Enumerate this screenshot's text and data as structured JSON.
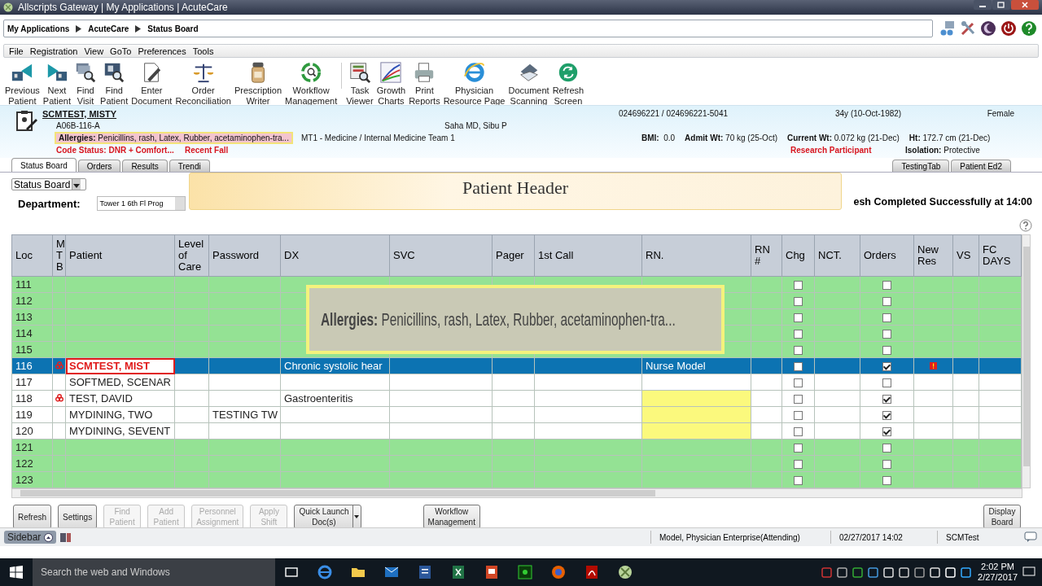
{
  "window": {
    "title": "Allscripts Gateway | My Applications | AcuteCare"
  },
  "breadcrumb": [
    "My Applications",
    "AcuteCare",
    "Status Board"
  ],
  "menu": [
    "File",
    "Registration",
    "View",
    "GoTo",
    "Preferences",
    "Tools"
  ],
  "toolbar": [
    {
      "lines": [
        "Previous",
        "Patient"
      ]
    },
    {
      "lines": [
        "Next",
        "Patient"
      ]
    },
    {
      "lines": [
        "Find",
        "Visit"
      ]
    },
    {
      "lines": [
        "Find",
        "Patient"
      ]
    },
    {
      "lines": [
        "Enter",
        "Document"
      ]
    },
    {
      "lines": [
        "Order",
        "Reconciliation"
      ]
    },
    {
      "lines": [
        "Prescription",
        "Writer"
      ]
    },
    {
      "lines": [
        "Workflow",
        "Management"
      ]
    },
    {
      "lines": [
        "Task",
        "Viewer"
      ]
    },
    {
      "lines": [
        "Growth",
        "Charts"
      ]
    },
    {
      "lines": [
        "Print",
        "Reports"
      ]
    },
    {
      "lines": [
        "Physician",
        "Resource Page"
      ]
    },
    {
      "lines": [
        "Document",
        "Scanning"
      ]
    },
    {
      "lines": [
        "Refresh",
        "Screen"
      ]
    }
  ],
  "patient": {
    "name": "SCMTEST, MISTY",
    "account": "024696221 / 024696221-5041",
    "age": "34y (10-Oct-1982)",
    "sex": "Female",
    "location": "A06B-116-A",
    "physician": "Saha   MD, Sibu P",
    "allergies": "**Allergies:** Penicillins, rash, Latex, Rubber, acetaminophen-tra...",
    "team": "MT1 - Medicine / Internal Medicine Team 1",
    "measures": [
      "**BMI:**  0.0",
      "**Admit Wt:** 70 kg (25-Oct)",
      "**Current Wt:** 0.072 kg (21-Dec)",
      "**Ht:** 172.7 cm (21-Dec)"
    ],
    "code_status": "Code Status: DNR + Comfort...",
    "flag": "Recent Fall",
    "research": "Research Participant",
    "isolation": "**Isolation:** Protective"
  },
  "tabs_left": [
    {
      "label": "Status Board",
      "selected": true
    },
    {
      "label": "Orders",
      "selected": false
    },
    {
      "label": "Results",
      "selected": false
    },
    {
      "label": "Trendi",
      "selected": false
    }
  ],
  "tabs_right": [
    {
      "label": "TestingTab",
      "selected": false
    },
    {
      "label": "Patient Ed2",
      "selected": false
    }
  ],
  "board": {
    "view": "Status Board",
    "department_label": "Department:",
    "department": "Tower 1 6th Fl Prog",
    "refresh_message": "esh Completed Successfully at 14:00"
  },
  "table": {
    "columns": [
      "Loc",
      "M T B",
      "Patient",
      "Level of Care",
      "Password",
      "DX",
      "SVC",
      "Pager",
      "1st Call",
      "RN.",
      "RN #",
      "Chg",
      "NCT.",
      "Orders",
      "New Res",
      "VS",
      "FC DAYS"
    ],
    "rows": [
      {
        "loc": "111",
        "kind": "vacant",
        "selected": false,
        "isolation": false,
        "rn_highlight": false,
        "chg": false,
        "orders": false,
        "alert": false
      },
      {
        "loc": "112",
        "kind": "vacant",
        "selected": false,
        "isolation": false,
        "rn_highlight": false,
        "chg": false,
        "orders": false,
        "alert": false
      },
      {
        "loc": "113",
        "kind": "vacant",
        "selected": false,
        "isolation": false,
        "rn_highlight": false,
        "chg": false,
        "orders": false,
        "alert": false
      },
      {
        "loc": "114",
        "kind": "vacant",
        "selected": false,
        "isolation": false,
        "rn_highlight": false,
        "chg": false,
        "orders": false,
        "alert": false
      },
      {
        "loc": "115",
        "kind": "vacant",
        "selected": false,
        "isolation": false,
        "rn_highlight": false,
        "chg": false,
        "orders": false,
        "alert": false
      },
      {
        "loc": "116",
        "kind": "occupied",
        "selected": true,
        "isolation": true,
        "patient": "SCMTEST, MIST",
        "dx": "Chronic systolic hear",
        "rn": "Nurse Model",
        "rn_highlight": false,
        "chg": false,
        "orders": true,
        "alert": true
      },
      {
        "loc": "117",
        "kind": "occupied",
        "selected": false,
        "isolation": false,
        "patient": "SOFTMED, SCENAR",
        "rn_highlight": false,
        "chg": false,
        "orders": false,
        "alert": false
      },
      {
        "loc": "118",
        "kind": "occupied",
        "selected": false,
        "isolation": true,
        "patient": "TEST, DAVID",
        "dx": "Gastroenteritis",
        "rn_highlight": true,
        "chg": false,
        "orders": true,
        "alert": false
      },
      {
        "loc": "119",
        "kind": "occupied",
        "selected": false,
        "isolation": false,
        "patient": "MYDINING, TWO",
        "password": "TESTING TW",
        "rn_highlight": true,
        "chg": false,
        "orders": true,
        "alert": false
      },
      {
        "loc": "120",
        "kind": "occupied",
        "selected": false,
        "isolation": false,
        "patient": "MYDINING, SEVENT",
        "rn_highlight": true,
        "chg": false,
        "orders": true,
        "alert": false
      },
      {
        "loc": "121",
        "kind": "vacant",
        "selected": false,
        "isolation": false,
        "rn_highlight": false,
        "chg": false,
        "orders": false,
        "alert": false
      },
      {
        "loc": "122",
        "kind": "vacant",
        "selected": false,
        "isolation": false,
        "rn_highlight": false,
        "chg": false,
        "orders": false,
        "alert": false
      },
      {
        "loc": "123",
        "kind": "vacant",
        "selected": false,
        "isolation": false,
        "rn_highlight": false,
        "chg": false,
        "orders": false,
        "alert": false
      }
    ]
  },
  "buttons_left": [
    {
      "lines": [
        "Refresh"
      ],
      "disabled": false,
      "kind": "plain"
    },
    {
      "lines": [
        "Settings"
      ],
      "disabled": false,
      "kind": "plain"
    },
    {
      "lines": [
        "Find",
        "Patient"
      ],
      "disabled": true,
      "kind": "plain"
    },
    {
      "lines": [
        "Add",
        "Patient"
      ],
      "disabled": true,
      "kind": "plain"
    },
    {
      "lines": [
        "Personnel",
        "Assignment"
      ],
      "disabled": true,
      "kind": "plain"
    },
    {
      "lines": [
        "Apply",
        "Shift"
      ],
      "disabled": true,
      "kind": "plain"
    },
    {
      "lines": [
        "Quick Launch",
        "Doc(s)"
      ],
      "disabled": false,
      "kind": "split"
    }
  ],
  "buttons_middle": [
    {
      "lines": [
        "Workflow",
        "Management"
      ],
      "disabled": false,
      "kind": "plain"
    }
  ],
  "buttons_right": [
    {
      "lines": [
        "Display",
        "Board"
      ],
      "disabled": false,
      "kind": "plain"
    }
  ],
  "status_bar": {
    "sidebar": "Sidebar",
    "fields": [
      "Model, Physician Enterprise(Attending)",
      "02/27/2017 14:02",
      "SCMTest"
    ]
  },
  "taskbar": {
    "search_placeholder": "Search the web and Windows",
    "time": "2:02 PM",
    "date": "2/27/2017"
  },
  "callouts": [
    {
      "kind": "banner",
      "text": "Patient Header"
    },
    {
      "kind": "zoom",
      "text": "**Allergies:** Penicillins, rash, Latex, Rubber, acetaminophen-tra..."
    }
  ]
}
